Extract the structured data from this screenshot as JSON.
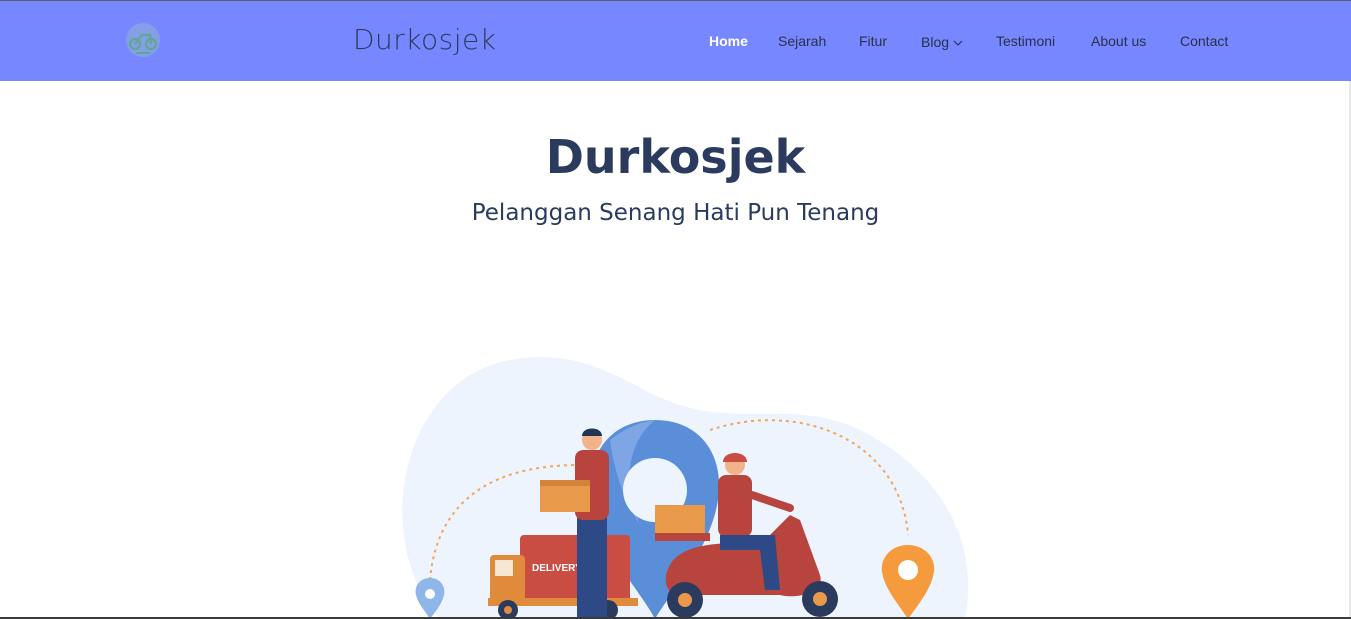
{
  "header": {
    "brand": "Durkosjek",
    "logo_icon": "scooter-logo-icon",
    "bg_color": "#7787ff"
  },
  "nav": {
    "items": [
      {
        "label": "Home",
        "active": true
      },
      {
        "label": "Sejarah"
      },
      {
        "label": "Fitur"
      },
      {
        "label": "Blog",
        "dropdown": true
      },
      {
        "label": "Testimoni"
      },
      {
        "label": "About us"
      },
      {
        "label": "Contact"
      }
    ]
  },
  "hero": {
    "title": "Durkosjek",
    "subtitle": "Pelanggan Senang Hati Pun Tenang",
    "truck_text": "DELIVERY"
  }
}
